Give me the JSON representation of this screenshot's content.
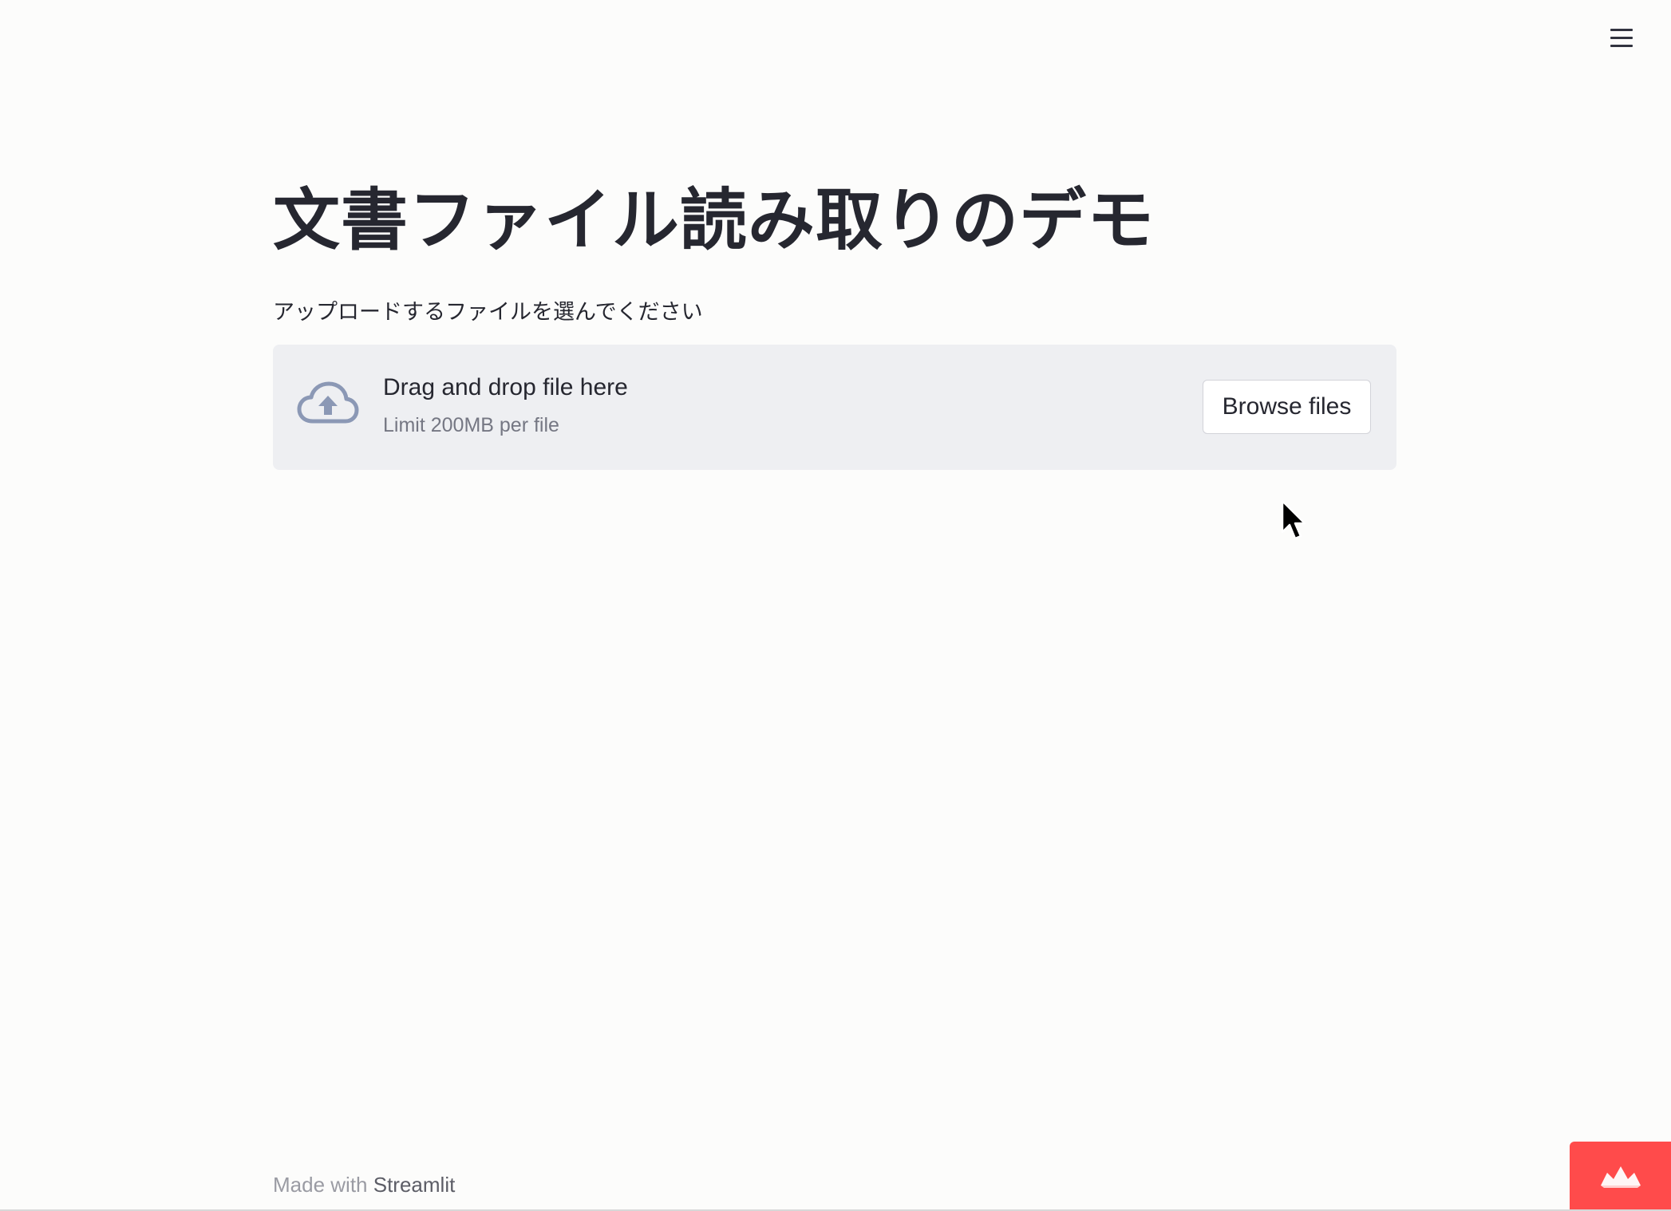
{
  "header": {
    "menu_icon": "hamburger-icon"
  },
  "main": {
    "title": "文書ファイル読み取りのデモ",
    "uploader": {
      "label": "アップロードするファイルを選んでください",
      "drop_text": "Drag and drop file here",
      "limit_text": "Limit 200MB per file",
      "browse_label": "Browse files",
      "icon": "cloud-upload-icon"
    }
  },
  "footer": {
    "prefix": "Made with",
    "brand": "Streamlit"
  },
  "deploy_badge": {
    "icon": "streamlit-crown-icon",
    "color": "#ff4b4b"
  },
  "colors": {
    "text": "#262730",
    "dropzone_bg": "#eeeff2",
    "icon_gray": "#8b98b5",
    "accent": "#ff4b4b"
  }
}
